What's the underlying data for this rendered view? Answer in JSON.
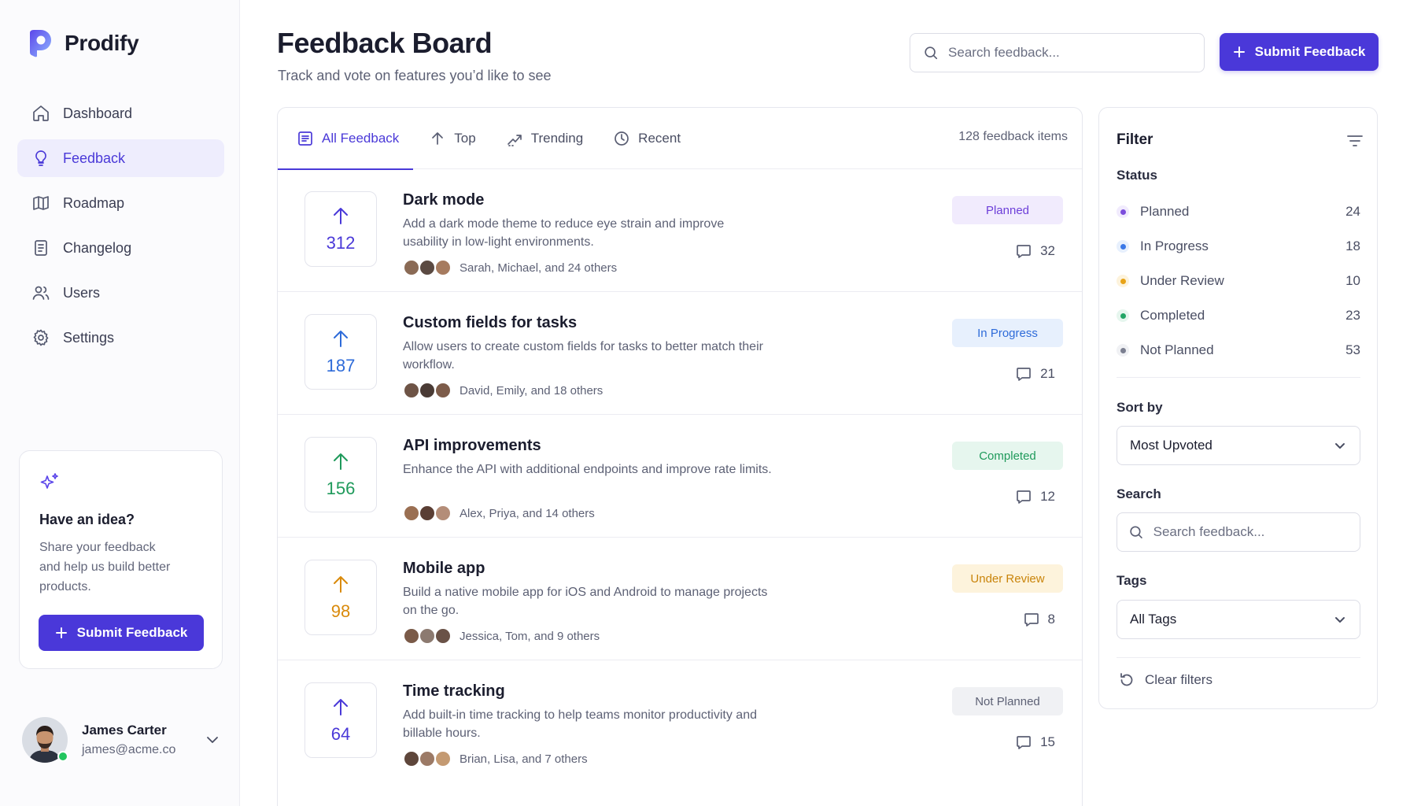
{
  "brand": {
    "name": "Prodify",
    "color": "#4a38d9"
  },
  "nav": [
    {
      "label": "Dashboard",
      "icon": "home-icon",
      "active": false
    },
    {
      "label": "Feedback",
      "icon": "lightbulb-icon",
      "active": true
    },
    {
      "label": "Roadmap",
      "icon": "map-icon",
      "active": false
    },
    {
      "label": "Changelog",
      "icon": "document-icon",
      "active": false
    },
    {
      "label": "Users",
      "icon": "users-icon",
      "active": false
    },
    {
      "label": "Settings",
      "icon": "gear-icon",
      "active": false
    }
  ],
  "idea_card": {
    "title": "Have an idea?",
    "text": "Share your feedback and help us build better products.",
    "button": "Submit Feedback"
  },
  "user": {
    "name": "James Carter",
    "email": "james@acme.co",
    "online": true
  },
  "header": {
    "title": "Feedback Board",
    "subtitle": "Track and vote on features you’d like to see",
    "search_placeholder": "Search feedback...",
    "submit_button": "Submit Feedback"
  },
  "tabs": [
    {
      "label": "All Feedback",
      "icon": "list-icon",
      "active": true
    },
    {
      "label": "Top",
      "icon": "arrow-up-icon",
      "active": false
    },
    {
      "label": "Trending",
      "icon": "trending-icon",
      "active": false
    },
    {
      "label": "Recent",
      "icon": "clock-icon",
      "active": false
    }
  ],
  "item_count": "128 feedback items",
  "items": [
    {
      "votes": "312",
      "title": "Dark mode",
      "description": "Add a dark mode theme to reduce eye strain and improve usability in low-light environments.",
      "voters": "Sarah, Michael, and 24 others",
      "status": "Planned",
      "comments": "32"
    },
    {
      "votes": "187",
      "title": "Custom fields for tasks",
      "description": "Allow users to create custom fields for tasks to better match their workflow.",
      "voters": "David, Emily, and 18 others",
      "status": "In Progress",
      "comments": "21"
    },
    {
      "votes": "156",
      "title": "API improvements",
      "description": "Enhance the API with additional endpoints and improve rate limits.",
      "voters": "Alex, Priya, and 14 others",
      "status": "Completed",
      "comments": "12"
    },
    {
      "votes": "98",
      "title": "Mobile app",
      "description": "Build a native mobile app for iOS and Android to manage projects on the go.",
      "voters": "Jessica, Tom, and 9 others",
      "status": "Under Review",
      "comments": "8"
    },
    {
      "votes": "64",
      "title": "Time tracking",
      "description": "Add built-in time tracking to help teams monitor productivity and billable hours.",
      "voters": "Brian, Lisa, and 7 others",
      "status": "Not Planned",
      "comments": "15"
    }
  ],
  "status_colors": {
    "Planned": {
      "fg": "#6d3fd9",
      "bg": "#f1ebfd",
      "dot": "#7c4ddc",
      "vote": "#4a39d8"
    },
    "In Progress": {
      "fg": "#2e6bd9",
      "bg": "#e7f0fd",
      "dot": "#3b78e7",
      "vote": "#2e6bd9"
    },
    "Completed": {
      "fg": "#1f9a5b",
      "bg": "#e6f6ee",
      "dot": "#22a565",
      "vote": "#1f9a5b"
    },
    "Under Review": {
      "fg": "#c9840a",
      "bg": "#fdf3dc",
      "dot": "#e8a317",
      "vote": "#d98a0b"
    },
    "Not Planned": {
      "fg": "#5d6175",
      "bg": "#f0f1f4",
      "dot": "#7b7f90",
      "vote": "#4a39d8"
    }
  },
  "filter": {
    "title": "Filter",
    "status_label": "Status",
    "statuses": [
      {
        "label": "Planned",
        "count": "24"
      },
      {
        "label": "In Progress",
        "count": "18"
      },
      {
        "label": "Under Review",
        "count": "10"
      },
      {
        "label": "Completed",
        "count": "23"
      },
      {
        "label": "Not Planned",
        "count": "53"
      }
    ],
    "sort_label": "Sort by",
    "sort_value": "Most Upvoted",
    "search_label": "Search",
    "search_placeholder": "Search feedback...",
    "tags_label": "Tags",
    "tags_value": "All Tags",
    "clear": "Clear filters"
  }
}
